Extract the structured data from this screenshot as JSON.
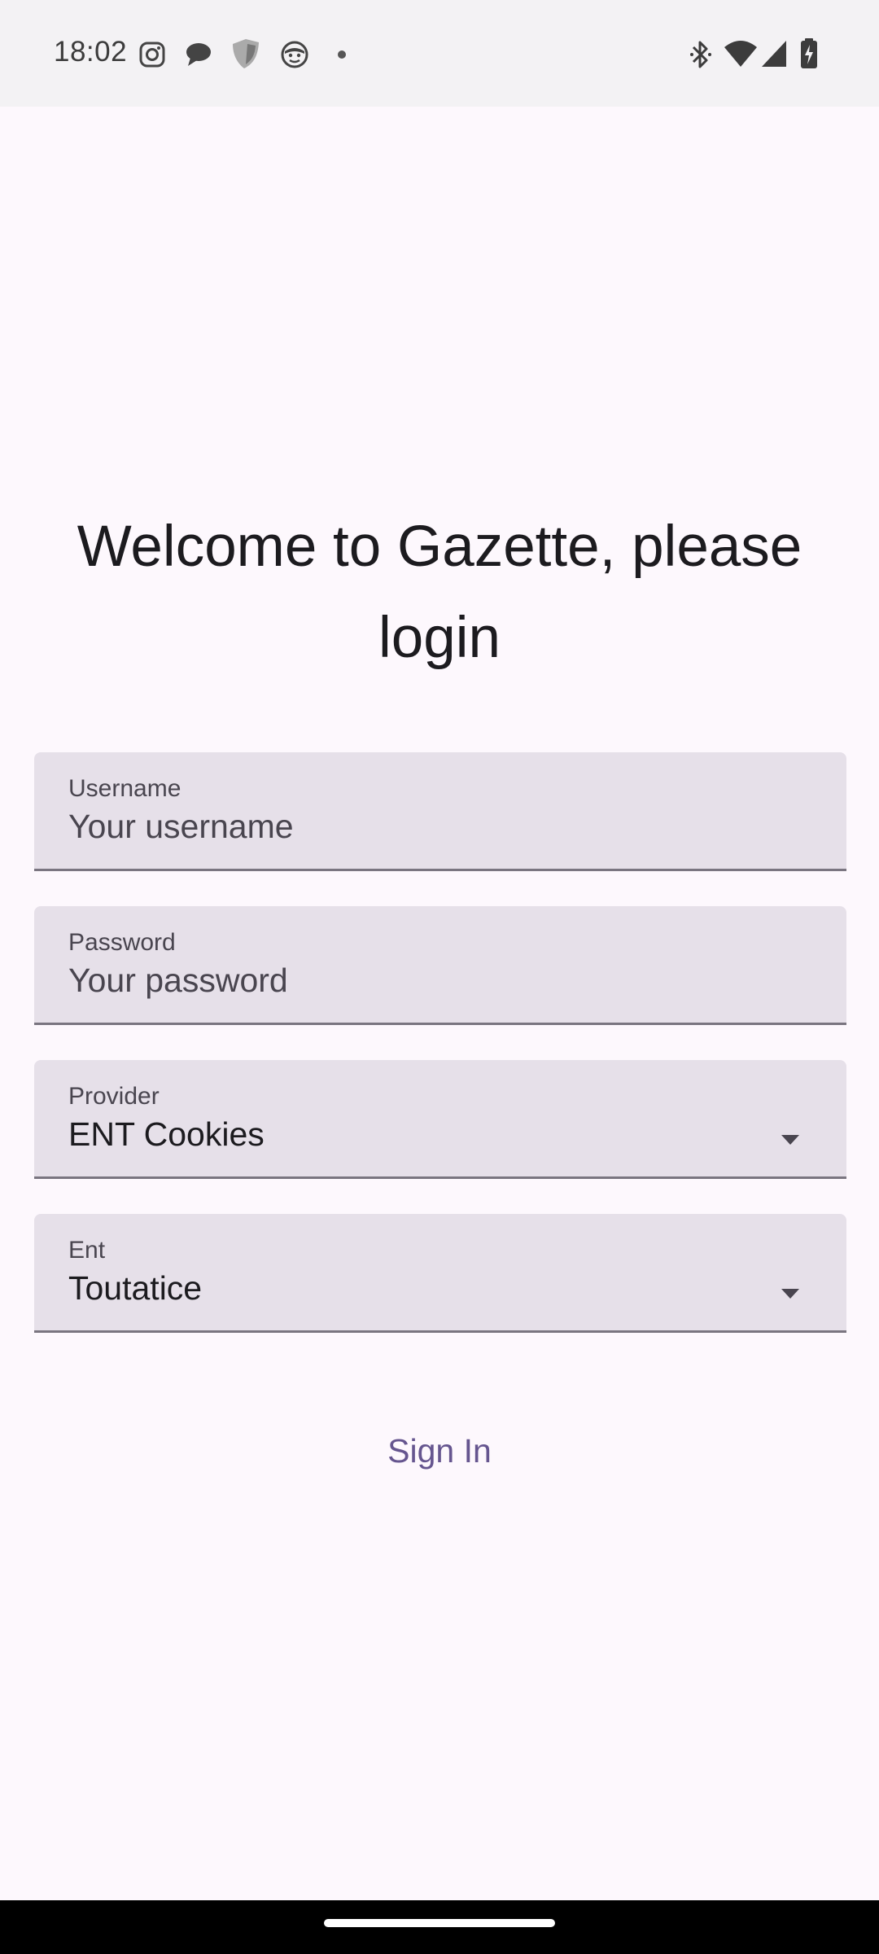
{
  "status_bar": {
    "time": "18:02",
    "notification_icons": [
      "instagram-icon",
      "chat-bubble-icon",
      "shield-app-icon",
      "mask-face-icon",
      "dot-icon"
    ],
    "system_icons": [
      "bluetooth-icon",
      "wifi-icon",
      "cell-signal-icon",
      "battery-charging-icon"
    ]
  },
  "login": {
    "title": "Welcome to Gazette, please login",
    "username": {
      "label": "Username",
      "placeholder": "Your username",
      "value": ""
    },
    "password": {
      "label": "Password",
      "placeholder": "Your password",
      "value": ""
    },
    "provider": {
      "label": "Provider",
      "selected": "ENT Cookies"
    },
    "ent": {
      "label": "Ent",
      "selected": "Toutatice"
    },
    "sign_in_label": "Sign In"
  },
  "colors": {
    "background": "#fdf8fd",
    "field_fill": "#e6e0e9",
    "accent": "#65558f",
    "text_primary": "#1c1b1f",
    "text_secondary": "#49454f"
  }
}
